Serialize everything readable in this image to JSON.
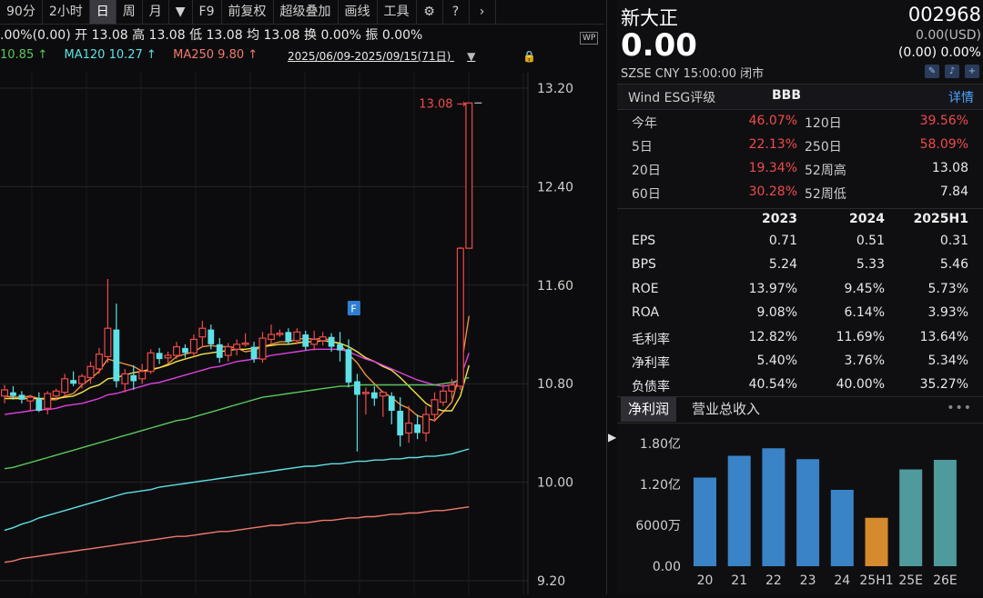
{
  "toolbar": {
    "items": [
      "90分",
      "2小时",
      "日",
      "周",
      "月",
      "▼",
      "F9",
      "前复权",
      "超级叠加",
      "画线",
      "工具"
    ],
    "active_index": 2,
    "settings_icon": "gear-icon",
    "help_icon": "help-icon",
    "collapse_icon": "chevron-right-icon"
  },
  "quote_line": ".00%(0.00)  开 13.08  高 13.08  低 13.08  均 13.08   换 0.00%  振 0.00%",
  "ma_line": {
    "ma_a": "10.85 ↑",
    "ma120": "MA120 10.27 ↑",
    "ma250": "MA250 9.80 ↑",
    "colors": {
      "ma_a": "#59c85a",
      "ma120": "#5ee1e6",
      "ma250": "#f07a6a"
    }
  },
  "date_range": "2025/06/09-2025/09/15(71日)",
  "wp_badge": "WP",
  "chart_data": {
    "type": "candlestick",
    "y_ticks": [
      "13.20",
      "12.40",
      "11.60",
      "10.80",
      "10.00",
      "9.20"
    ],
    "ylim": [
      9.2,
      13.2
    ],
    "last_price_label": "13.08",
    "event_marker": "F",
    "colors": {
      "up": "#ef4a4a",
      "down": "#5ee1e6",
      "ma5": "#f09040",
      "ma10": "#f2e24a",
      "ma20": "#e040e0",
      "ma60": "#59c85a",
      "ma120": "#5ee1e6",
      "ma250": "#f07a6a"
    },
    "candles": [
      {
        "o": 10.7,
        "h": 10.79,
        "l": 10.64,
        "c": 10.75
      },
      {
        "o": 10.73,
        "h": 10.78,
        "l": 10.67,
        "c": 10.7
      },
      {
        "o": 10.71,
        "h": 10.74,
        "l": 10.64,
        "c": 10.67
      },
      {
        "o": 10.66,
        "h": 10.71,
        "l": 10.58,
        "c": 10.69
      },
      {
        "o": 10.68,
        "h": 10.73,
        "l": 10.57,
        "c": 10.58
      },
      {
        "o": 10.6,
        "h": 10.74,
        "l": 10.55,
        "c": 10.72
      },
      {
        "o": 10.7,
        "h": 10.76,
        "l": 10.67,
        "c": 10.74
      },
      {
        "o": 10.73,
        "h": 10.88,
        "l": 10.7,
        "c": 10.84
      },
      {
        "o": 10.83,
        "h": 10.9,
        "l": 10.78,
        "c": 10.8
      },
      {
        "o": 10.8,
        "h": 10.88,
        "l": 10.76,
        "c": 10.86
      },
      {
        "o": 10.85,
        "h": 10.98,
        "l": 10.8,
        "c": 10.94
      },
      {
        "o": 10.92,
        "h": 11.09,
        "l": 10.88,
        "c": 11.04
      },
      {
        "o": 11.02,
        "h": 11.65,
        "l": 10.97,
        "c": 11.25
      },
      {
        "o": 11.24,
        "h": 11.45,
        "l": 10.77,
        "c": 10.82
      },
      {
        "o": 10.8,
        "h": 10.92,
        "l": 10.73,
        "c": 10.88
      },
      {
        "o": 10.87,
        "h": 10.95,
        "l": 10.75,
        "c": 10.82
      },
      {
        "o": 10.84,
        "h": 10.96,
        "l": 10.8,
        "c": 10.9
      },
      {
        "o": 10.9,
        "h": 11.08,
        "l": 10.88,
        "c": 11.05
      },
      {
        "o": 11.05,
        "h": 11.09,
        "l": 10.96,
        "c": 11.0
      },
      {
        "o": 11.01,
        "h": 11.06,
        "l": 10.97,
        "c": 11.03
      },
      {
        "o": 11.03,
        "h": 11.14,
        "l": 11.0,
        "c": 11.1
      },
      {
        "o": 11.09,
        "h": 11.12,
        "l": 11.01,
        "c": 11.05
      },
      {
        "o": 11.05,
        "h": 11.2,
        "l": 11.02,
        "c": 11.16
      },
      {
        "o": 11.18,
        "h": 11.31,
        "l": 11.1,
        "c": 11.25
      },
      {
        "o": 11.24,
        "h": 11.28,
        "l": 11.08,
        "c": 11.12
      },
      {
        "o": 11.12,
        "h": 11.17,
        "l": 10.97,
        "c": 11.01
      },
      {
        "o": 11.03,
        "h": 11.13,
        "l": 10.98,
        "c": 11.1
      },
      {
        "o": 11.08,
        "h": 11.16,
        "l": 11.03,
        "c": 11.12
      },
      {
        "o": 11.12,
        "h": 11.21,
        "l": 11.1,
        "c": 11.13
      },
      {
        "o": 11.1,
        "h": 11.14,
        "l": 10.97,
        "c": 11.0
      },
      {
        "o": 11.0,
        "h": 11.22,
        "l": 10.97,
        "c": 11.17
      },
      {
        "o": 11.16,
        "h": 11.28,
        "l": 11.12,
        "c": 11.2
      },
      {
        "o": 11.2,
        "h": 11.24,
        "l": 11.18,
        "c": 11.21
      },
      {
        "o": 11.22,
        "h": 11.25,
        "l": 11.12,
        "c": 11.14
      },
      {
        "o": 11.15,
        "h": 11.25,
        "l": 11.12,
        "c": 11.22
      },
      {
        "o": 11.2,
        "h": 11.23,
        "l": 11.07,
        "c": 11.1
      },
      {
        "o": 11.12,
        "h": 11.23,
        "l": 11.07,
        "c": 11.16
      },
      {
        "o": 11.15,
        "h": 11.22,
        "l": 11.11,
        "c": 11.18
      },
      {
        "o": 11.18,
        "h": 11.21,
        "l": 11.06,
        "c": 11.1
      },
      {
        "o": 11.12,
        "h": 11.22,
        "l": 10.98,
        "c": 11.07
      },
      {
        "o": 11.08,
        "h": 11.16,
        "l": 10.77,
        "c": 10.81
      },
      {
        "o": 10.82,
        "h": 10.88,
        "l": 10.25,
        "c": 10.71
      },
      {
        "o": 10.72,
        "h": 10.77,
        "l": 10.55,
        "c": 10.73
      },
      {
        "o": 10.73,
        "h": 10.78,
        "l": 10.62,
        "c": 10.68
      },
      {
        "o": 10.7,
        "h": 10.74,
        "l": 10.53,
        "c": 10.73
      },
      {
        "o": 10.7,
        "h": 10.73,
        "l": 10.47,
        "c": 10.58
      },
      {
        "o": 10.58,
        "h": 10.69,
        "l": 10.29,
        "c": 10.38
      },
      {
        "o": 10.4,
        "h": 10.62,
        "l": 10.32,
        "c": 10.48
      },
      {
        "o": 10.47,
        "h": 10.55,
        "l": 10.35,
        "c": 10.4
      },
      {
        "o": 10.4,
        "h": 10.62,
        "l": 10.33,
        "c": 10.55
      },
      {
        "o": 10.55,
        "h": 10.73,
        "l": 10.49,
        "c": 10.67
      },
      {
        "o": 10.65,
        "h": 10.8,
        "l": 10.62,
        "c": 10.74
      },
      {
        "o": 10.74,
        "h": 10.84,
        "l": 10.68,
        "c": 10.79
      },
      {
        "o": 10.78,
        "h": 11.91,
        "l": 10.75,
        "c": 11.9
      },
      {
        "o": 11.9,
        "h": 13.08,
        "l": 11.92,
        "c": 13.08
      }
    ],
    "ma_lines": {
      "ma5": [
        10.7,
        10.69,
        10.69,
        10.7,
        10.68,
        10.67,
        10.67,
        10.7,
        10.72,
        10.79,
        10.84,
        10.9,
        11.0,
        10.98,
        10.96,
        10.94,
        10.9,
        10.92,
        10.93,
        10.96,
        11.02,
        11.04,
        11.06,
        11.1,
        11.11,
        11.1,
        11.1,
        11.09,
        11.06,
        11.07,
        11.1,
        11.12,
        11.14,
        11.14,
        11.16,
        11.17,
        11.16,
        11.17,
        11.15,
        11.12,
        11.04,
        10.97,
        10.87,
        10.8,
        10.73,
        10.69,
        10.63,
        10.6,
        10.54,
        10.52,
        10.5,
        10.57,
        10.65,
        10.9,
        11.35
      ],
      "ma10": [
        10.68,
        10.68,
        10.68,
        10.68,
        10.68,
        10.68,
        10.68,
        10.69,
        10.7,
        10.73,
        10.77,
        10.79,
        10.84,
        10.85,
        10.87,
        10.89,
        10.9,
        10.91,
        10.93,
        10.95,
        10.98,
        11.0,
        11.02,
        11.04,
        11.05,
        11.06,
        11.07,
        11.08,
        11.08,
        11.09,
        11.1,
        11.11,
        11.12,
        11.12,
        11.13,
        11.14,
        11.14,
        11.15,
        11.14,
        11.13,
        11.1,
        11.06,
        11.01,
        10.98,
        10.94,
        10.91,
        10.85,
        10.78,
        10.71,
        10.64,
        10.6,
        10.58,
        10.58,
        10.7,
        10.95
      ],
      "ma20": [
        10.55,
        10.56,
        10.57,
        10.58,
        10.59,
        10.59,
        10.6,
        10.62,
        10.63,
        10.64,
        10.66,
        10.68,
        10.71,
        10.72,
        10.74,
        10.76,
        10.78,
        10.8,
        10.81,
        10.83,
        10.85,
        10.87,
        10.89,
        10.91,
        10.93,
        10.94,
        10.96,
        10.98,
        10.99,
        11.0,
        11.01,
        11.03,
        11.04,
        11.05,
        11.06,
        11.07,
        11.08,
        11.08,
        11.08,
        11.08,
        11.06,
        11.03,
        11.0,
        10.98,
        10.95,
        10.92,
        10.89,
        10.86,
        10.83,
        10.81,
        10.79,
        10.78,
        10.79,
        10.85,
        11.05
      ],
      "ma60": [
        10.11,
        10.12,
        10.14,
        10.16,
        10.18,
        10.2,
        10.22,
        10.24,
        10.26,
        10.28,
        10.3,
        10.32,
        10.34,
        10.36,
        10.38,
        10.4,
        10.42,
        10.44,
        10.46,
        10.48,
        10.5,
        10.51,
        10.53,
        10.55,
        10.57,
        10.59,
        10.61,
        10.63,
        10.65,
        10.67,
        10.69,
        10.7,
        10.71,
        10.72,
        10.73,
        10.74,
        10.75,
        10.76,
        10.77,
        10.78,
        10.78,
        10.79,
        10.79,
        10.79,
        10.79,
        10.79,
        10.79,
        10.79,
        10.79,
        10.79,
        10.79,
        10.8,
        10.81,
        10.83,
        10.85
      ],
      "ma120": [
        9.61,
        9.63,
        9.66,
        9.68,
        9.71,
        9.73,
        9.75,
        9.77,
        9.79,
        9.81,
        9.83,
        9.85,
        9.87,
        9.89,
        9.91,
        9.92,
        9.93,
        9.94,
        9.96,
        9.97,
        9.98,
        9.99,
        10.0,
        10.01,
        10.02,
        10.03,
        10.04,
        10.05,
        10.06,
        10.07,
        10.08,
        10.09,
        10.1,
        10.11,
        10.12,
        10.13,
        10.13,
        10.14,
        10.15,
        10.15,
        10.16,
        10.17,
        10.17,
        10.18,
        10.18,
        10.19,
        10.19,
        10.2,
        10.2,
        10.21,
        10.21,
        10.22,
        10.23,
        10.25,
        10.27
      ],
      "ma250": [
        9.35,
        9.36,
        9.38,
        9.39,
        9.4,
        9.41,
        9.42,
        9.43,
        9.44,
        9.45,
        9.46,
        9.47,
        9.48,
        9.49,
        9.5,
        9.51,
        9.52,
        9.53,
        9.54,
        9.55,
        9.56,
        9.56,
        9.57,
        9.58,
        9.59,
        9.6,
        9.6,
        9.61,
        9.62,
        9.63,
        9.64,
        9.65,
        9.65,
        9.66,
        9.67,
        9.67,
        9.68,
        9.69,
        9.69,
        9.7,
        9.71,
        9.71,
        9.72,
        9.72,
        9.73,
        9.74,
        9.74,
        9.75,
        9.75,
        9.76,
        9.77,
        9.77,
        9.78,
        9.79,
        9.8
      ]
    },
    "event_marker_index": 42
  },
  "sidebar": {
    "name": "新大正",
    "code": "002968",
    "price": "0.00",
    "usd": "0.00(USD)",
    "change": "(0.00)  0.00%",
    "meta": "SZSE  CNY  15:00:00   闭市",
    "esg_label": "Wind ESG评级",
    "esg_value": "BBB",
    "esg_link": "详情",
    "returns": [
      {
        "l1": "今年",
        "v1": "46.07%",
        "l2": "120日",
        "v2": "39.56%"
      },
      {
        "l1": "5日",
        "v1": "22.13%",
        "l2": "250日",
        "v2": "58.09%"
      },
      {
        "l1": "20日",
        "v1": "19.34%",
        "l2": "52周高",
        "v2": "13.08"
      },
      {
        "l1": "60日",
        "v1": "30.28%",
        "l2": "52周低",
        "v2": "7.84"
      }
    ],
    "fin_years": [
      "2023",
      "2024",
      "2025H1"
    ],
    "fin_rows": [
      {
        "label": "EPS",
        "v": [
          "0.71",
          "0.51",
          "0.31"
        ]
      },
      {
        "label": "BPS",
        "v": [
          "5.24",
          "5.33",
          "5.46"
        ]
      },
      {
        "label": "ROE",
        "v": [
          "13.97%",
          "9.45%",
          "5.73%"
        ]
      },
      {
        "label": "ROA",
        "v": [
          "9.08%",
          "6.14%",
          "3.93%"
        ]
      },
      {
        "label": "毛利率",
        "v": [
          "12.82%",
          "11.69%",
          "13.64%"
        ]
      },
      {
        "label": "净利率",
        "v": [
          "5.40%",
          "3.76%",
          "5.34%"
        ]
      },
      {
        "label": "负债率",
        "v": [
          "40.54%",
          "40.00%",
          "35.27%"
        ]
      }
    ],
    "tabs": [
      "净利润",
      "营业总收入"
    ],
    "more": "•••",
    "profit_chart": {
      "type": "bar",
      "categories": [
        "20",
        "21",
        "22",
        "23",
        "24",
        "25H1",
        "25E",
        "26E"
      ],
      "values": [
        1.3,
        1.62,
        1.73,
        1.57,
        1.12,
        0.71,
        1.42,
        1.56
      ],
      "unit": "亿",
      "y_ticks": [
        "1.80亿",
        "1.20亿",
        "6000万",
        "0.00"
      ],
      "ylim": [
        0,
        1.8
      ],
      "colors": [
        "#3a83c7",
        "#3a83c7",
        "#3a83c7",
        "#3a83c7",
        "#3a83c7",
        "#d58a2e",
        "#4e9a9c",
        "#4e9a9c"
      ]
    }
  }
}
